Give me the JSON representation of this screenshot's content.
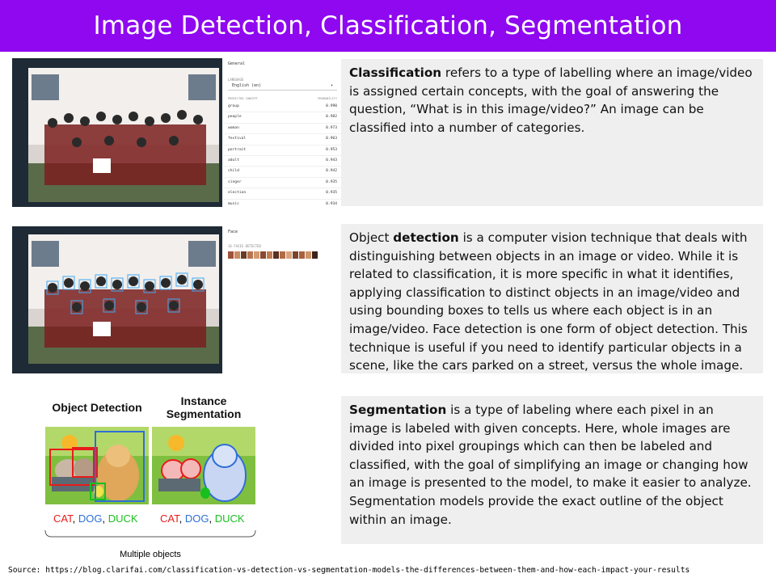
{
  "title": "Image Detection, Classification, Segmentation",
  "classification": {
    "panel": {
      "header": "General",
      "language_label": "LANGUAGE",
      "language_value": "English (en)",
      "col_concept": "PREDICTED CONCEPT",
      "col_probability": "PROBABILITY",
      "concepts": [
        {
          "name": "group",
          "prob": "0.990"
        },
        {
          "name": "people",
          "prob": "0.982"
        },
        {
          "name": "woman",
          "prob": "0.973"
        },
        {
          "name": "festival",
          "prob": "0.963"
        },
        {
          "name": "portrait",
          "prob": "0.953"
        },
        {
          "name": "adult",
          "prob": "0.943"
        },
        {
          "name": "child",
          "prob": "0.942"
        },
        {
          "name": "singer",
          "prob": "0.935"
        },
        {
          "name": "election",
          "prob": "0.935"
        },
        {
          "name": "music",
          "prob": "0.934"
        }
      ]
    },
    "desc_bold": "Classification",
    "desc_rest": " refers to a type of labelling where an image/video is assigned certain concepts, with the goal of answering the question, “What is in this image/video?” An image can be classified into a number of categories."
  },
  "detection": {
    "panel": {
      "header": "Face",
      "faces_label": "16 FACES DETECTED"
    },
    "desc_pre": "Object ",
    "desc_bold": "detection",
    "desc_rest": " is a computer vision technique that deals with distinguishing between objects in an image or video. While it is related to classification, it is more specific in what it identifies, applying classification to distinct objects in an image/video and using bounding boxes to tells us where each object is in an image/video. Face detection is one form of object detection. This technique is useful if you need to identify particular objects in a scene, like the cars parked on a street, versus the whole image."
  },
  "segmentation": {
    "figure": {
      "left_title": "Object Detection",
      "right_title_1": "Instance",
      "right_title_2": "Segmentation",
      "cat": "CAT",
      "dog": "DOG",
      "duck": "DUCK",
      "sep": ", ",
      "caption": "Multiple objects"
    },
    "desc_bold": "Segmentation",
    "desc_rest": " is a type of labeling where each pixel in an image is labeled with given concepts. Here, whole images are divided into pixel groupings which can then be labeled and classified, with the goal of simplifying an image or changing how an image is presented to the model, to make it easier to analyze. Segmentation models provide the exact outline of the object within an image."
  },
  "source": "Source: https://blog.clarifai.com/classification-vs-detection-vs-segmentation-models-the-differences-between-them-and-how-each-impact-your-results",
  "colors": {
    "title_bg": "#8f08f0",
    "desc_bg": "#efefef",
    "cat": "#e81c1c",
    "dog": "#2f6fd6",
    "duck": "#18c01f"
  }
}
